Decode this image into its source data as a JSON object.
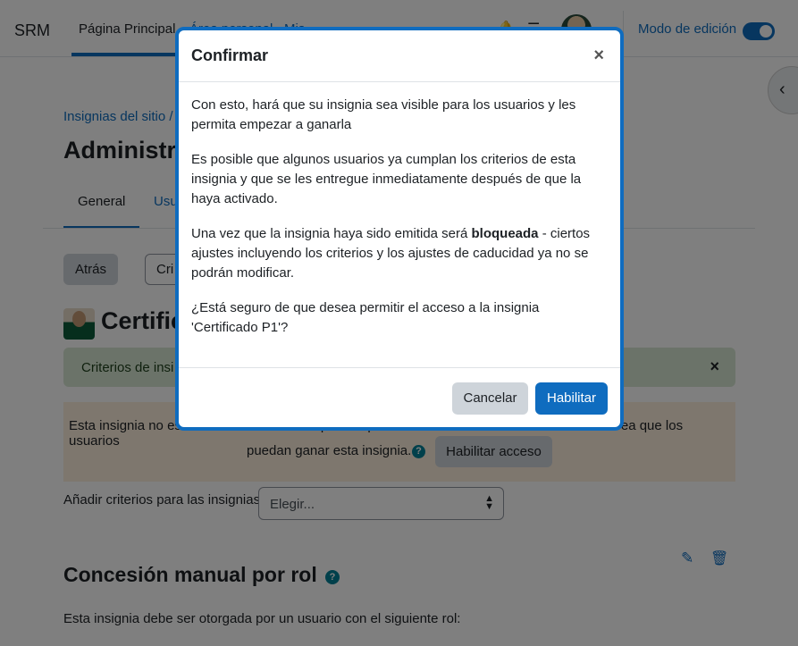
{
  "navbar": {
    "brand": "SRM",
    "links": [
      "Página Principal",
      "Área personal",
      "Mis"
    ],
    "edit_mode_label": "Modo de edición",
    "edit_mode_on": true
  },
  "page": {
    "breadcrumb": "Insignias del sitio",
    "breadcrumb_sep": "/",
    "title": "Administra",
    "tabs": [
      "General",
      "Usu"
    ],
    "back_button": "Atrás",
    "criteria_dropdown_partial": "Cri",
    "badge_title": "Certific",
    "success_alert": "Criterios de insi",
    "success_close": "×",
    "warning_text_line1": "Esta insignia no está en este momento disponible para los usuarios. Habilite el acceso si desea que los usuarios",
    "warning_text_line2": "puedan ganar esta insignia.",
    "enable_access_button": "Habilitar acceso",
    "add_criteria_label": "Añadir criterios para las insignias",
    "add_criteria_selected": "Elegir...",
    "section_title": "Concesión manual por rol",
    "section_text": "Esta insignia debe ser otorgada por un usuario con el siguiente rol:"
  },
  "modal": {
    "title": "Confirmar",
    "close": "×",
    "p1": "Con esto, hará que su insignia sea visible para los usuarios y les permita empezar a ganarla",
    "p2": "Es posible que algunos usuarios ya cumplan los criterios de esta insignia y que se les entregue inmediatamente después de que la haya activado.",
    "p3_prefix": "Una vez que la insignia haya sido emitida será ",
    "p3_bold": "bloqueada",
    "p3_suffix": " - ciertos ajustes incluyendo los criterios y los ajustes de caducidad ya no se podrán modificar.",
    "p4": "¿Está seguro de que desea permitir el acceso a la insignia 'Certificado P1'?",
    "cancel_button": "Cancelar",
    "confirm_button": "Habilitar"
  },
  "icons": {
    "help": "?",
    "edit": "✎",
    "trash": "🗑",
    "drawer": "‹",
    "select_arrows": "▲▼"
  },
  "colors": {
    "primary": "#0f6cbf",
    "help": "#008196",
    "success_bg": "#d7e6d2",
    "warning_bg": "#fcefdc"
  }
}
